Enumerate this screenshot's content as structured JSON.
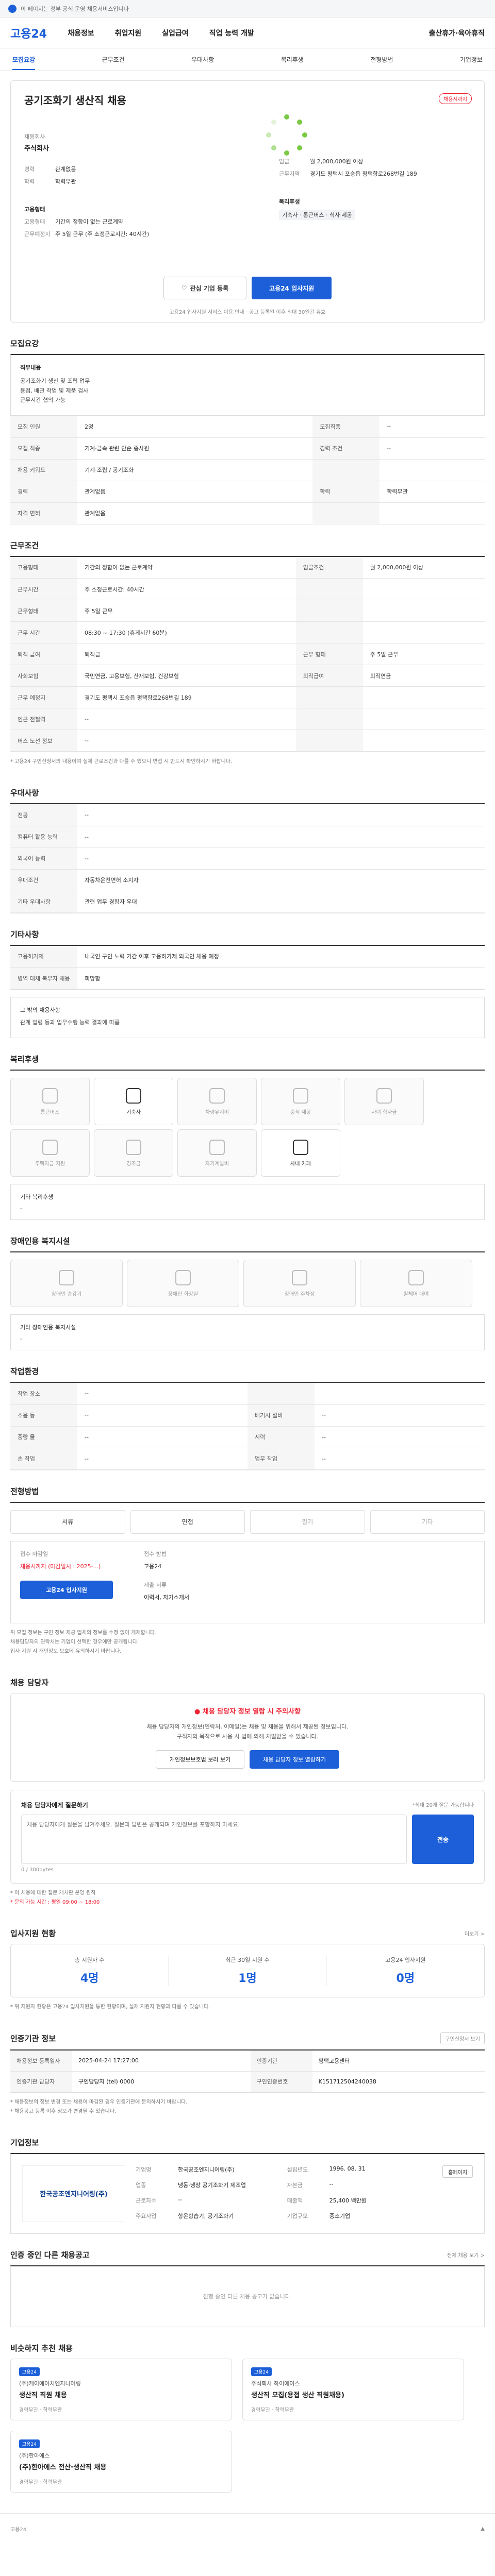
{
  "topbar": {
    "text": "이 페이지는 정부 공식 운영 채용서비스입니다"
  },
  "header": {
    "logo": "고용24",
    "menu": [
      "채용정보",
      "취업지원",
      "실업급여",
      "직업 능력 개발"
    ],
    "right": "출산휴가·육아휴직"
  },
  "subnav": [
    "모집요강",
    "근무조건",
    "우대사항",
    "복리후생",
    "전형방법",
    "기업정보"
  ],
  "hero": {
    "title": "공기조화기 생산직 채용",
    "badge": "채용시까지",
    "sub_label": "채용회사",
    "company": "주식회사",
    "left": [
      {
        "k": "경력",
        "v": "관계없음"
      },
      {
        "k": "학력",
        "v": "학력무관"
      }
    ],
    "left2": [
      {
        "k": "고용형태",
        "v": ""
      },
      {
        "k": "고용형태",
        "v": "기간의 정함이 없는 근로계약"
      },
      {
        "k": "근무예정지",
        "v": "주 5일 근무 (주 소정근로시간: 40시간)"
      }
    ],
    "right": [
      {
        "k": "임금",
        "v": "월 2,000,000원 이상"
      },
      {
        "k": "근무지역",
        "v": "경기도 평택시 포승읍 평택항로268번길 189"
      }
    ],
    "right2": [
      {
        "k": "복리후생",
        "v": ""
      },
      {
        "k": "",
        "v": "기숙사 · 통근버스 · 식사 제공"
      }
    ],
    "btn_interest": "관심 기업 등록",
    "btn_apply": "고용24 입사지원",
    "note": "고용24 입사지원 서비스 이용 안내 · 공고 등록일 이후 최대 30일간 유효"
  },
  "recruit": {
    "title": "모집요강",
    "job_label": "직무내용",
    "job_text": "공기조화기 생산 및 조립 업무\n용접, 배관 작업 및 제품 검사\n근무시간 협의 가능",
    "rows": [
      [
        {
          "k": "모집 인원",
          "v": "2명"
        },
        {
          "k": "모집직종",
          "v": "--"
        }
      ],
      [
        {
          "k": "모집 직종",
          "v": "기계·금속 관련 단순 종사원"
        },
        {
          "k": "경력 조건",
          "v": "--"
        }
      ],
      [
        {
          "k": "채용 키워드",
          "v": "기계·조립 / 공기조화"
        },
        {
          "k": "",
          "v": ""
        }
      ],
      [
        {
          "k": "경력",
          "v": "관계없음"
        },
        {
          "k": "학력",
          "v": "학력무관"
        }
      ],
      [
        {
          "k": "자격 면허",
          "v": "관계없음"
        },
        {
          "k": "",
          "v": ""
        }
      ]
    ]
  },
  "work": {
    "title": "근무조건",
    "rows": [
      [
        {
          "k": "고용형태",
          "v": "기간의 정함이 없는 근로계약"
        },
        {
          "k": "임금조건",
          "v": "월 2,000,000원 이상"
        }
      ],
      [
        {
          "k": "근무시간",
          "v": "주 소정근로시간: 40시간"
        },
        {
          "k": "",
          "v": ""
        }
      ],
      [
        {
          "k": "근무형태",
          "v": "주 5일 근무"
        },
        {
          "k": "",
          "v": ""
        }
      ],
      [
        {
          "k": "근무 시간",
          "v": "08:30 ~ 17:30 (휴게시간 60분)"
        },
        {
          "k": "",
          "v": ""
        }
      ],
      [
        {
          "k": "퇴직 급여",
          "v": "퇴직금"
        },
        {
          "k": "근무 형태",
          "v": "주 5일 근무"
        }
      ],
      [
        {
          "k": "사회보험",
          "v": "국민연금, 고용보험, 산재보험, 건강보험"
        },
        {
          "k": "퇴직급여",
          "v": "퇴직연금"
        }
      ],
      [
        {
          "k": "근무 예정지",
          "v": "경기도 평택시 포승읍 평택항로268번길 189"
        },
        {
          "k": "",
          "v": ""
        }
      ],
      [
        {
          "k": "인근 전철역",
          "v": "--"
        },
        {
          "k": "",
          "v": ""
        }
      ],
      [
        {
          "k": "버스 노선 정보",
          "v": "--"
        },
        {
          "k": "",
          "v": ""
        }
      ]
    ],
    "map_btn": "지도 보기",
    "note": "* 고용24 구인신청서의 내용이며 실제 근로조건과 다를 수 있으니 면접 시 반드시 확인하시기 바랍니다."
  },
  "pref": {
    "title": "우대사항",
    "rows": [
      [
        {
          "k": "전공",
          "v": "--"
        }
      ],
      [
        {
          "k": "컴퓨터 활용 능력",
          "v": "--"
        }
      ],
      [
        {
          "k": "외국어 능력",
          "v": "--"
        }
      ],
      [
        {
          "k": "우대조건",
          "v": "자동차운전면허 소지자"
        }
      ],
      [
        {
          "k": "기타 우대사항",
          "v": "관련 업무 경험자 우대"
        }
      ]
    ]
  },
  "etc": {
    "title": "기타사항",
    "rows": [
      [
        {
          "k": "고용허가제",
          "v": "내국인 구인 노력 기간 이후 고용허가제 외국인 채용 예정"
        }
      ],
      [
        {
          "k": "병역 대체 복무자 채용",
          "v": "희망함"
        }
      ]
    ],
    "extra_label": "그 밖의 채용사항",
    "extra_text": "관계 법령 등과 업무수행 능력 결과에 따름"
  },
  "welfare": {
    "title": "복리후생",
    "items": [
      {
        "label": "통근버스",
        "on": false
      },
      {
        "label": "기숙사",
        "on": true
      },
      {
        "label": "차량유지비",
        "on": false
      },
      {
        "label": "중식 제공",
        "on": false
      },
      {
        "label": "자녀 학자금",
        "on": false
      },
      {
        "label": "주택자금 지원",
        "on": false
      },
      {
        "label": "경조금",
        "on": false
      },
      {
        "label": "자기계발비",
        "on": false
      },
      {
        "label": "사내 카페",
        "on": true
      }
    ],
    "other_label": "기타 복리후생",
    "other_value": "-"
  },
  "disability": {
    "title": "장애인용 복지시설",
    "items": [
      "장애인 승강기",
      "장애인 화장실",
      "장애인 주차장",
      "휠체어 대여"
    ],
    "other_label": "기타 장애인용 복지시설",
    "other_value": "-"
  },
  "env": {
    "title": "작업환경",
    "rows": [
      [
        {
          "k": "작업 장소",
          "v": "--"
        },
        {
          "k": "",
          "v": ""
        }
      ],
      [
        {
          "k": "소음 등",
          "v": "--"
        },
        {
          "k": "배기시 설비",
          "v": "--"
        }
      ],
      [
        {
          "k": "중량 물",
          "v": "--"
        },
        {
          "k": "시력",
          "v": "--"
        }
      ],
      [
        {
          "k": "손 작업",
          "v": "--"
        },
        {
          "k": "업무 작업",
          "v": "--"
        }
      ]
    ]
  },
  "selection": {
    "title": "전형방법",
    "steps": [
      {
        "label": "서류",
        "on": true
      },
      {
        "label": "면접",
        "on": true
      },
      {
        "label": "필기",
        "on": false
      },
      {
        "label": "기타",
        "on": false
      }
    ],
    "apply_way_label": "접수 마감일",
    "apply_way": "채용시까지 (마감일시 : 2025-...)",
    "apply_method_label": "접수 방법",
    "apply_method": "고용24",
    "doc_label": "제출 서류",
    "doc_value": "이력서, 자기소개서",
    "apply_btn": "고용24 입사지원",
    "notes": [
      "위 모집 정보는 구인 정보 제공 업체의 정보를 수정 없이 게재합니다.",
      "채용담당자의 연락처는 기업이 선택한 경우에만 공개됩니다.",
      "입사 지원 시 개인정보 보호에 유의하시기 바랍니다."
    ]
  },
  "contact": {
    "title": "채용 담당자",
    "warn": "채용 담당자 정보 열람 시 주의사항",
    "text1": "채용 담당자의 개인정보(연락처, 이메일)는 채용 및 채용을 위해서 제공된 정보입니다.",
    "text2": "구직자의 목적으로 사용 시 법에 의해 처벌받을 수 있습니다.",
    "btn1": "개인정보보호법 보러 보기",
    "btn2": "채용 담당자 정보 열람하기",
    "ask_title": "채용 담당자에게 질문하기",
    "ask_sub": "*최대 20개 질문 가능합니다",
    "ask_placeholder": "채용 담당자에게 질문을 남겨주세요. 질문과 답변은 공개되며 개인정보를 포함하지 마세요.",
    "ask_btn": "전송",
    "ask_count": "0 / 300bytes",
    "notes": [
      "* 이 채용에 대한 질문 게시판 운영 원칙",
      "* 문의 가능 시간 : 평일 09:00 ~ 18:00"
    ]
  },
  "applicant": {
    "title": "입사지원 현황",
    "more": "더보기 >",
    "stats": [
      {
        "label": "총 지원자 수",
        "value": "4명"
      },
      {
        "label": "최근 30일 지원 수",
        "value": "1명"
      },
      {
        "label": "고용24 입사지원",
        "value": "0명"
      }
    ],
    "note": "* 위 지원자 현황은 고용24 입사지원을 통한 현황이며, 실제 지원자 현황과 다를 수 있습니다."
  },
  "regist": {
    "title": "인증기관 정보",
    "more": "구인신청서 보기",
    "rows": [
      [
        {
          "k": "채용정보 등록일자",
          "v": "2025-04-24 17:27:00"
        },
        {
          "k": "인증기관",
          "v": "평택고용센터"
        }
      ],
      [
        {
          "k": "인증기관 담당자",
          "v": "구인담당자 (tel) 0000"
        },
        {
          "k": "구인인증번호",
          "v": "K151712504240038"
        }
      ]
    ],
    "notes": [
      "* 채용정보의 정보 변경 또는 채용이 마감된 경우 인증기관에 문의하시기 바랍니다.",
      "* 채용공고 등록 이후 정보가 변경될 수 있습니다."
    ]
  },
  "company": {
    "title": "기업정보",
    "logo_text": "한국공조엔지니어링(주)",
    "info": [
      {
        "k": "기업명",
        "v": "한국공조엔지니어링(주)"
      },
      {
        "k": "설립년도",
        "v": "1996. 08. 31"
      },
      {
        "k": "업종",
        "v": "냉동·냉장 공기조화기 제조업"
      },
      {
        "k": "자본금",
        "v": "--"
      },
      {
        "k": "근로자수",
        "v": "--"
      },
      {
        "k": "매출액",
        "v": "25,400 백만원"
      },
      {
        "k": "주요사업",
        "v": "항온항습기, 공기조화기"
      },
      {
        "k": "기업규모",
        "v": "중소기업"
      }
    ],
    "home_btn": "홈페이지"
  },
  "other": {
    "title": "인증 중인 다른 채용공고",
    "more": "전체 채용 보기 >",
    "empty": "진행 중인 다른 채용 공고가 없습니다."
  },
  "similar": {
    "title": "비슷하지 추천 채용",
    "cards": [
      {
        "tag": "고용24",
        "co": "(주)케이에이치엔지니어링",
        "tt": "생산직 직원 채용",
        "meta": "경력무관 · 학력무관"
      },
      {
        "tag": "고용24",
        "co": "주식회사 하이에이스",
        "tt": "생산직 모집(용접 생산 직원채용)",
        "meta": "경력무관 · 학력무관"
      },
      {
        "tag": "고용24",
        "co": "(주)한아에스",
        "tt": "(주)한아에스 전산·생산직 채용",
        "meta": "경력무관 · 학력무관"
      }
    ]
  }
}
